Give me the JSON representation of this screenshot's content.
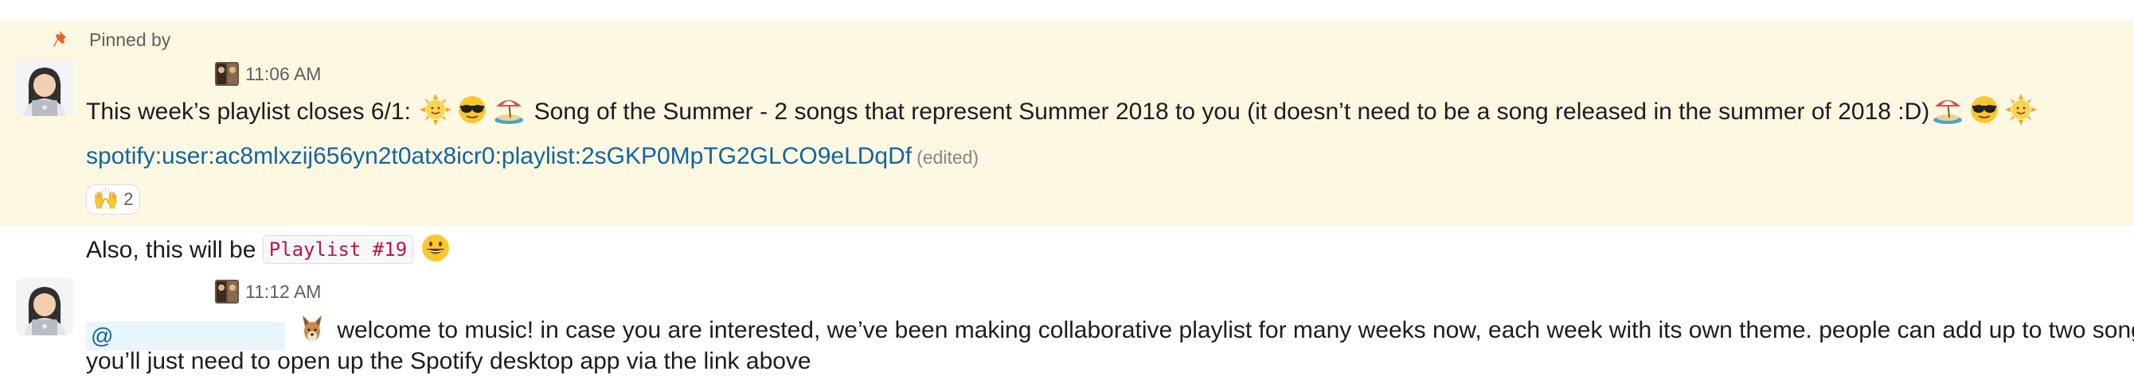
{
  "pin": {
    "label": "Pinned by",
    "icon": "pin-icon"
  },
  "messages": [
    {
      "time": "11:06 AM",
      "text_before": "This week’s playlist closes 6/1: ",
      "text_middle": " Song of the Summer - 2 songs that represent Summer 2018 to you (it doesn’t need to be a song released in the summer of 2018 :D)",
      "link": "spotify:user:ac8mlxzij656yn2t0atx8icr0:playlist:2sGKP0MpTG2GLCO9eLDqDf",
      "edited": "(edited)",
      "reaction": {
        "emoji": "🙌",
        "count": "2"
      }
    },
    {
      "text_before": "Also, this will be ",
      "code": "Playlist #19"
    },
    {
      "time": "11:12 AM",
      "mention": "@",
      "text_line1": " welcome to music! in case you are interested, we’ve been making collaborative playlist for many weeks now, each week with its own theme. people can add up to two songs,",
      "text_line2": "you’ll just need to open up the Spotify desktop app via the link above"
    }
  ],
  "icons": [
    "pin-icon",
    "sun-with-face-icon",
    "sunglasses-face-icon",
    "beach-umbrella-icon",
    "grinning-face-icon",
    "raised-hands-icon",
    "dog-icon"
  ],
  "colors": {
    "pinned_bg": "#fdf8e1",
    "link": "#1264a3",
    "code_text": "#c01343",
    "mention_bg": "#e8f5fa"
  }
}
